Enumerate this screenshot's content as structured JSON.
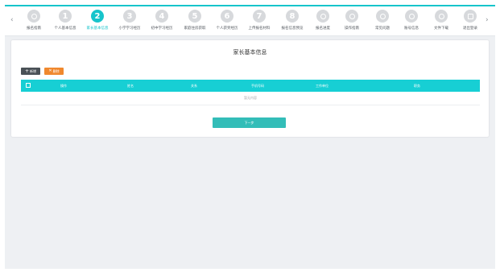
{
  "nav": {
    "prev_arrow": "‹",
    "next_arrow": "›",
    "steps": [
      {
        "label": "报名指南",
        "num": "",
        "icon": "dot-circle-icon",
        "active": false
      },
      {
        "label": "个人基本信息",
        "num": "1",
        "icon": "",
        "active": false
      },
      {
        "label": "家长基本信息",
        "num": "2",
        "icon": "",
        "active": true
      },
      {
        "label": "小学学习经历",
        "num": "3",
        "icon": "",
        "active": false
      },
      {
        "label": "初中学习经历",
        "num": "4",
        "icon": "",
        "active": false
      },
      {
        "label": "家庭住房获取",
        "num": "5",
        "icon": "",
        "active": false
      },
      {
        "label": "个人获奖经历",
        "num": "6",
        "icon": "",
        "active": false
      },
      {
        "label": "上传报名材料",
        "num": "7",
        "icon": "",
        "active": false
      },
      {
        "label": "报名信息预览",
        "num": "8",
        "icon": "",
        "active": false
      },
      {
        "label": "报名进度",
        "num": "",
        "icon": "gauge-icon",
        "active": false
      },
      {
        "label": "操作指南",
        "num": "",
        "icon": "compass-icon",
        "active": false
      },
      {
        "label": "常见问题",
        "num": "",
        "icon": "question-icon",
        "active": false
      },
      {
        "label": "账号信息",
        "num": "",
        "icon": "user-icon",
        "active": false
      },
      {
        "label": "文件下载",
        "num": "",
        "icon": "download-icon",
        "active": false
      },
      {
        "label": "退出登录",
        "num": "",
        "icon": "logout-icon",
        "active": false
      }
    ]
  },
  "page": {
    "title": "家长基本信息",
    "add_label": "新增",
    "delete_label": "删除",
    "columns": [
      "操作",
      "姓名",
      "关系",
      "手机号码",
      "工作单位",
      "职务"
    ],
    "empty_text": "暂无内容",
    "next_label": "下一步"
  },
  "colors": {
    "accent": "#17c4cb",
    "header_bg": "#17cfd4",
    "delete_bg": "#f0882e",
    "add_bg": "#4a5157",
    "next_bg": "#33bdb8"
  }
}
